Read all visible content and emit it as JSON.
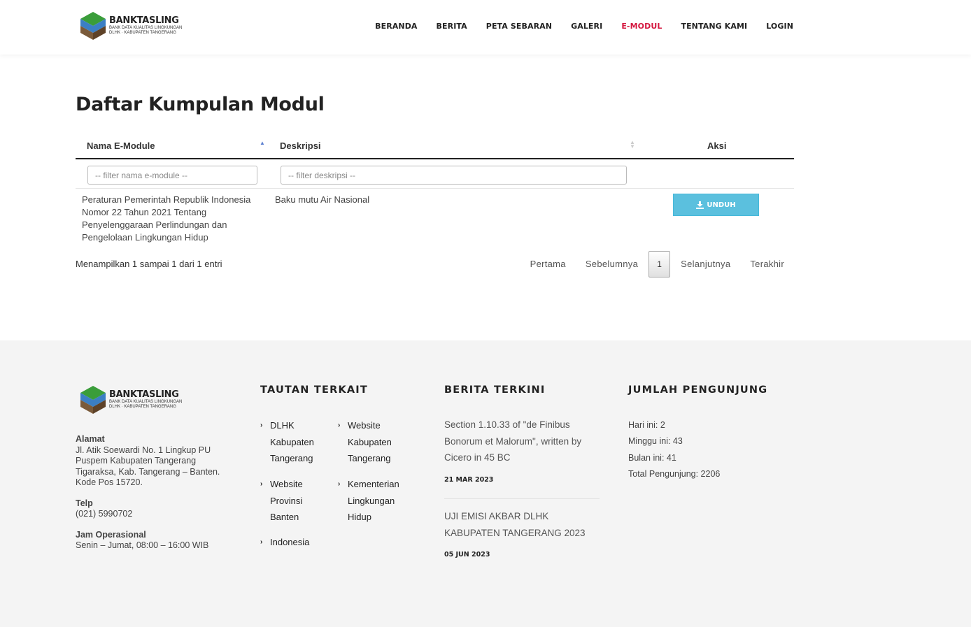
{
  "brand": {
    "title": "BANKTASLING",
    "sub1": "BANK DATA KUALITAS LINGKUNGAN",
    "sub2": "DLHK · KABUPATEN TANGERANG"
  },
  "nav": {
    "items": [
      "BERANDA",
      "BERITA",
      "PETA SEBARAN",
      "GALERI",
      "E-MODUL",
      "TENTANG KAMI",
      "LOGIN"
    ],
    "active": "E-MODUL"
  },
  "page": {
    "title": "Daftar Kumpulan Modul"
  },
  "table": {
    "columns": [
      "Nama E-Module",
      "Deskripsi",
      "Aksi"
    ],
    "filters": {
      "name_placeholder": "-- filter nama e-module --",
      "desc_placeholder": "-- filter deskripsi --"
    },
    "rows": [
      {
        "name": "Peraturan Pemerintah Republik Indonesia Nomor 22 Tahun 2021 Tentang Penyelenggaraan Perlindungan dan Pengelolaan Lingkungan Hidup",
        "description": "Baku mutu Air Nasional",
        "action": "UNDUH"
      }
    ],
    "info": "Menampilkan 1 sampai 1 dari 1 entri"
  },
  "pagination": {
    "first": "Pertama",
    "prev": "Sebelumnya",
    "current": "1",
    "next": "Selanjutnya",
    "last": "Terakhir"
  },
  "footer": {
    "address_label": "Alamat",
    "address_lines": [
      "Jl. Atik Soewardi No. 1 Lingkup PU",
      "Puspem Kabupaten Tangerang",
      "Tigaraksa, Kab. Tangerang – Banten.",
      "Kode Pos 15720."
    ],
    "phone_label": "Telp",
    "phone": "(021) 5990702",
    "hours_label": "Jam Operasional",
    "hours": "Senin – Jumat, 08:00 – 16:00 WIB",
    "links_heading": "TAUTAN TERKAIT",
    "links": [
      "DLHK Kabupaten Tangerang",
      "Website Kabupaten Tangerang",
      "Website Provinsi Banten",
      "Kementerian Lingkungan Hidup",
      "Indonesia"
    ],
    "news_heading": "BERITA TERKINI",
    "news": [
      {
        "title": "Section 1.10.33 of \"de Finibus Bonorum et Malorum\", written by Cicero in 45 BC",
        "date": "21 MAR 2023"
      },
      {
        "title": "UJI EMISI AKBAR DLHK KABUPATEN TANGERANG 2023",
        "date": "05 JUN 2023"
      }
    ],
    "visitors_heading": "JUMLAH PENGUNJUNG",
    "visitors": [
      "Hari ini: 2",
      "Minggu ini: 43",
      "Bulan ini: 41",
      "Total Pengunjung: 2206"
    ]
  },
  "colors": {
    "accent_red": "#d4173f",
    "button_blue": "#5bc0de",
    "footer_bg": "#f4f4f4"
  }
}
